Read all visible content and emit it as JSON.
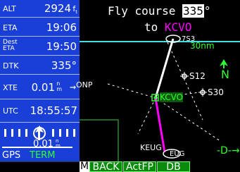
{
  "panel": {
    "alt_label": "ALT",
    "alt_value": "2924",
    "eta_label": "ETA",
    "eta_value": "19:06",
    "dest_eta_label_1": "Dest",
    "dest_eta_label_2": "ETA",
    "dest_eta_value": "19:50",
    "dtk_label": "DTK",
    "dtk_value": "335°",
    "xte_label": "XTE",
    "xte_value": "0.01",
    "utc_label": "UTC",
    "utc_value": "18:55:57",
    "cdi_value": "0.01",
    "gps_label": "GPS",
    "term_label": "TERM"
  },
  "banner": {
    "line1_prefix": "Fly course",
    "course": "335",
    "deg": "°",
    "line2_prefix": "to",
    "dest": "KCVO"
  },
  "map": {
    "range": "30nm",
    "north_label": "N",
    "waypoints": [
      "S12",
      "S30",
      "KCVO",
      "KEUG",
      "ONP"
    ],
    "partial_labels": [
      "7S3",
      "EUG"
    ],
    "dto_label": "-D-→"
  },
  "softkeys": {
    "m": "M",
    "back": "BACK",
    "actfp": "ActFP",
    "db": "DB"
  },
  "colors": {
    "panel_blue": "#1a3fd6",
    "magenta": "#ff00ff",
    "green": "#2eff2e",
    "cyan": "#3fe0e0"
  }
}
